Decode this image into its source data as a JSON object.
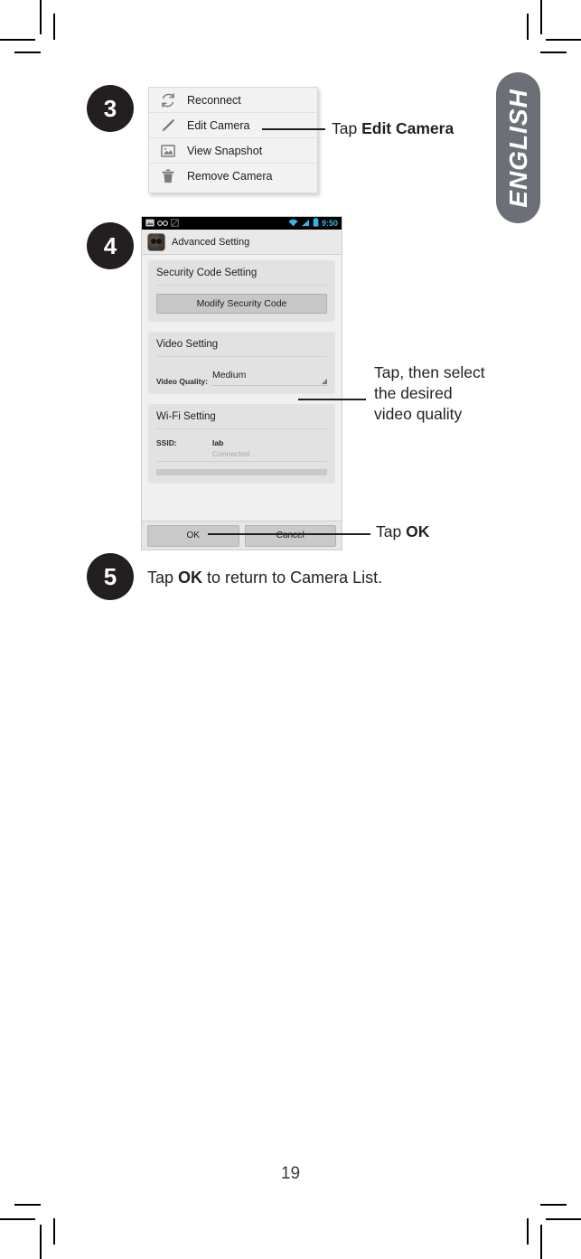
{
  "page": {
    "number": "19",
    "language_tab": "ENGLISH"
  },
  "steps": [
    {
      "number": "3"
    },
    {
      "number": "4"
    },
    {
      "number": "5"
    }
  ],
  "context_menu": {
    "items": [
      {
        "icon": "refresh-icon",
        "label": "Reconnect"
      },
      {
        "icon": "pencil-icon",
        "label": "Edit Camera"
      },
      {
        "icon": "image-icon",
        "label": "View Snapshot"
      },
      {
        "icon": "trash-icon",
        "label": "Remove Camera"
      }
    ]
  },
  "phone": {
    "statusbar": {
      "time": "9:50",
      "left_icons": [
        "picture-icon",
        "voicemail-icon",
        "sync-icon"
      ],
      "right_icons": [
        "wifi-icon",
        "signal-icon",
        "battery-icon"
      ]
    },
    "actionbar": {
      "title": "Advanced Setting",
      "icon": "camera-app-icon"
    },
    "cards": [
      {
        "title": "Security Code Setting",
        "button": "Modify Security Code"
      },
      {
        "title": "Video Setting",
        "field_label": "Video Quality:",
        "field_value": "Medium"
      },
      {
        "title": "Wi-Fi Setting",
        "field_label": "SSID:",
        "field_value": "lab",
        "field_status": "Connected"
      }
    ],
    "buttons": {
      "ok": "OK",
      "cancel": "Cancel"
    }
  },
  "callouts": {
    "edit_camera": {
      "prefix": "Tap ",
      "strong": "Edit Camera"
    },
    "video_quality": "Tap, then select\nthe desired\nvideo quality",
    "ok": {
      "prefix": "Tap ",
      "strong": "OK"
    }
  },
  "step5": {
    "prefix": "Tap ",
    "strong": "OK",
    "suffix": " to return to Camera List."
  }
}
